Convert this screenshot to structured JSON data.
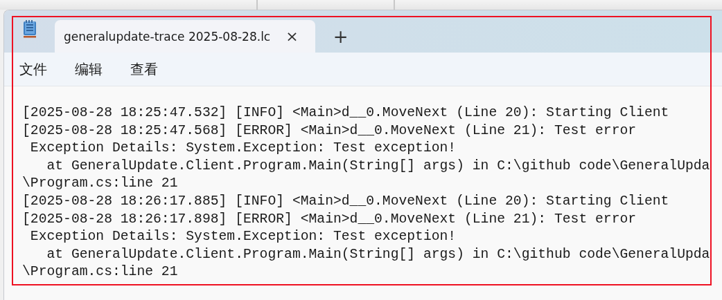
{
  "tabs": [
    {
      "title": "generalupdate-trace 2025-08-28.lc",
      "close": "×",
      "selected": true
    }
  ],
  "new_tab": "+",
  "menu": [
    "文件",
    "编辑",
    "查看"
  ],
  "lines": [
    "[2025-08-28 18:25:47.532] [INFO] <Main>d__0.MoveNext (Line 20): Starting Client",
    "[2025-08-28 18:25:47.568] [ERROR] <Main>d__0.MoveNext (Line 21): Test error",
    " Exception Details: System.Exception: Test exception!",
    "   at GeneralUpdate.Client.Program.Main(String[] args) in C:\\github code\\GeneralUpda",
    "\\Program.cs:line 21",
    "[2025-08-28 18:26:17.885] [INFO] <Main>d__0.MoveNext (Line 20): Starting Client",
    "[2025-08-28 18:26:17.898] [ERROR] <Main>d__0.MoveNext (Line 21): Test error",
    " Exception Details: System.Exception: Test exception!",
    "   at GeneralUpdate.Client.Program.Main(String[] args) in C:\\github code\\GeneralUpda",
    "\\Program.cs:line 21"
  ]
}
